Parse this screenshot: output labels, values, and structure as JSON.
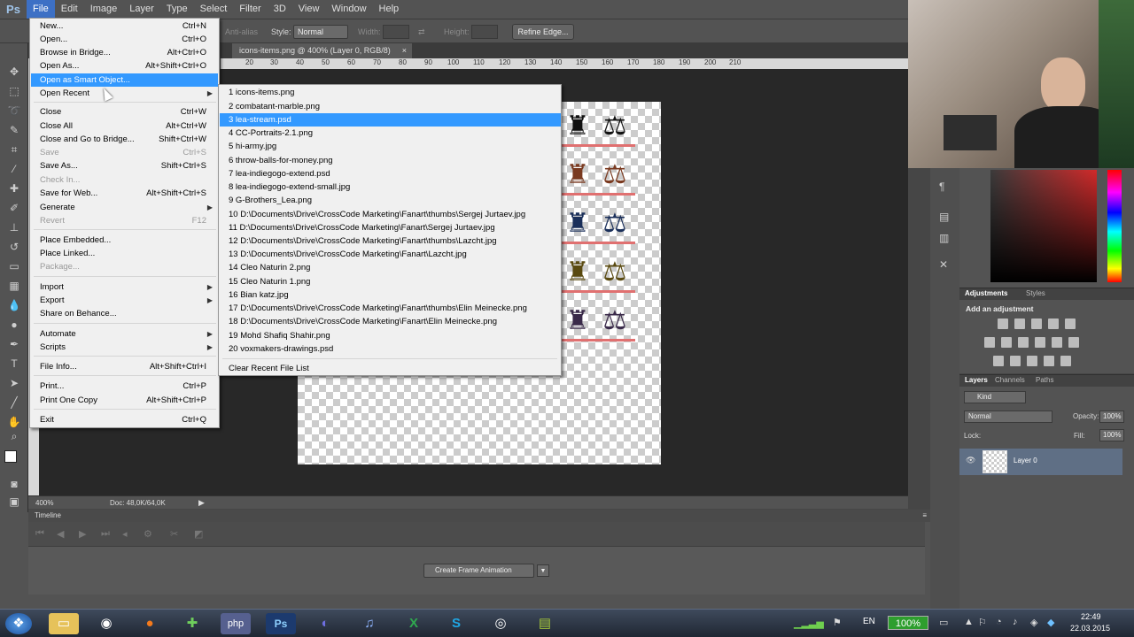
{
  "menubar": {
    "logo": "Ps",
    "items": [
      "File",
      "Edit",
      "Image",
      "Layer",
      "Type",
      "Select",
      "Filter",
      "3D",
      "View",
      "Window",
      "Help"
    ]
  },
  "options": {
    "antialias": "Anti-alias",
    "style_label": "Style:",
    "style_value": "Normal",
    "width_label": "Width:",
    "height_label": "Height:",
    "refine_edge": "Refine Edge..."
  },
  "document": {
    "tab_title": "icons-items.png @ 400% (Layer 0, RGB/8)",
    "close": "×",
    "ruler_ticks": [
      "20",
      "30",
      "40",
      "50",
      "60",
      "70",
      "80",
      "90",
      "100",
      "110",
      "120",
      "130",
      "140",
      "150",
      "160",
      "170",
      "180",
      "190",
      "200",
      "210"
    ]
  },
  "status": {
    "zoom": "400%",
    "doc": "Doc: 48,0K/64,0K"
  },
  "timeline": {
    "title": "Timeline",
    "create_button": "Create Frame Animation"
  },
  "file_menu": {
    "items": [
      {
        "label": "New...",
        "shortcut": "Ctrl+N"
      },
      {
        "label": "Open...",
        "shortcut": "Ctrl+O"
      },
      {
        "label": "Browse in Bridge...",
        "shortcut": "Alt+Ctrl+O"
      },
      {
        "label": "Open As...",
        "shortcut": "Alt+Shift+Ctrl+O"
      },
      {
        "label": "Open as Smart Object...",
        "shortcut": ""
      },
      {
        "label": "Open Recent",
        "shortcut": ""
      },
      {
        "label": "Close",
        "shortcut": "Ctrl+W"
      },
      {
        "label": "Close All",
        "shortcut": "Alt+Ctrl+W"
      },
      {
        "label": "Close and Go to Bridge...",
        "shortcut": "Shift+Ctrl+W"
      },
      {
        "label": "Save",
        "shortcut": "Ctrl+S"
      },
      {
        "label": "Save As...",
        "shortcut": "Shift+Ctrl+S"
      },
      {
        "label": "Check In...",
        "shortcut": ""
      },
      {
        "label": "Save for Web...",
        "shortcut": "Alt+Shift+Ctrl+S"
      },
      {
        "label": "Generate",
        "shortcut": ""
      },
      {
        "label": "Revert",
        "shortcut": "F12"
      },
      {
        "label": "Place Embedded...",
        "shortcut": ""
      },
      {
        "label": "Place Linked...",
        "shortcut": ""
      },
      {
        "label": "Package...",
        "shortcut": ""
      },
      {
        "label": "Import",
        "shortcut": ""
      },
      {
        "label": "Export",
        "shortcut": ""
      },
      {
        "label": "Share on Behance...",
        "shortcut": ""
      },
      {
        "label": "Automate",
        "shortcut": ""
      },
      {
        "label": "Scripts",
        "shortcut": ""
      },
      {
        "label": "File Info...",
        "shortcut": "Alt+Shift+Ctrl+I"
      },
      {
        "label": "Print...",
        "shortcut": "Ctrl+P"
      },
      {
        "label": "Print One Copy",
        "shortcut": "Alt+Shift+Ctrl+P"
      },
      {
        "label": "Exit",
        "shortcut": "Ctrl+Q"
      }
    ]
  },
  "recent_menu": {
    "items": [
      "1  icons-items.png",
      "2  combatant-marble.png",
      "3  lea-stream.psd",
      "4  CC-Portraits-2.1.png",
      "5  hi-army.jpg",
      "6  throw-balls-for-money.png",
      "7  lea-indiegogo-extend.psd",
      "8  lea-indiegogo-extend-small.jpg",
      "9  G-Brothers_Lea.png",
      "10  D:\\Documents\\Drive\\CrossCode Marketing\\Fanart\\thumbs\\Sergej Jurtaev.jpg",
      "11  D:\\Documents\\Drive\\CrossCode Marketing\\Fanart\\Sergej Jurtaev.jpg",
      "12  D:\\Documents\\Drive\\CrossCode Marketing\\Fanart\\thumbs\\Lazcht.jpg",
      "13  D:\\Documents\\Drive\\CrossCode Marketing\\Fanart\\Lazcht.jpg",
      "14  Cleo Naturin 2.png",
      "15  Cleo Naturin 1.png",
      "16  Bian katz.jpg",
      "17  D:\\Documents\\Drive\\CrossCode Marketing\\Fanart\\thumbs\\Elin Meinecke.png",
      "18  D:\\Documents\\Drive\\CrossCode Marketing\\Fanart\\Elin Meinecke.png",
      "19  Mohd Shafiq Shahir.png",
      "20  voxmakers-drawings.psd"
    ],
    "clear": "Clear Recent File List"
  },
  "adjustments": {
    "tab1": "Adjustments",
    "tab2": "Styles",
    "heading": "Add an adjustment"
  },
  "layers": {
    "tab1": "Layers",
    "tab2": "Channels",
    "tab3": "Paths",
    "kind": "Kind",
    "blend": "Normal",
    "opacity_label": "Opacity:",
    "opacity": "100%",
    "lock_label": "Lock:",
    "fill_label": "Fill:",
    "fill": "100%",
    "layer_name": "Layer 0"
  },
  "taskbar": {
    "lang": "EN",
    "battery": "100%",
    "time": "22:49",
    "date": "22.03.2015"
  },
  "colors": {
    "accent": "#3399ff",
    "menubar_active": "#3d70c5"
  }
}
